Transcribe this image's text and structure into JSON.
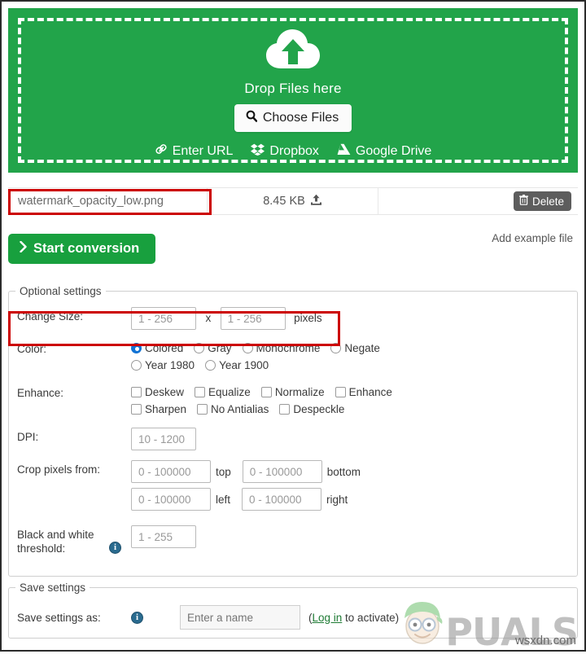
{
  "dropzone": {
    "icon": "cloud-upload-icon",
    "drop_label": "Drop Files here",
    "choose_files_label": "Choose Files",
    "choose_files_icon": "search-icon",
    "sources": [
      {
        "label": "Enter URL",
        "icon": "link-icon"
      },
      {
        "label": "Dropbox",
        "icon": "dropbox-icon"
      },
      {
        "label": "Google Drive",
        "icon": "google-drive-icon"
      }
    ],
    "background_color": "#22a44a"
  },
  "file_row": {
    "name": "watermark_opacity_low.png",
    "size": "8.45 KB",
    "upload_icon": "upload-icon",
    "delete_label": "Delete",
    "delete_icon": "trash-icon"
  },
  "actions": {
    "start_conversion_label": "Start conversion",
    "start_conversion_icon": "chevron-right-icon",
    "add_example_label": "Add example file"
  },
  "optional_settings": {
    "legend": "Optional settings",
    "change_size": {
      "label": "Change Size:",
      "width_placeholder": "1 - 256",
      "width_value": "",
      "separator": "x",
      "height_placeholder": "1 - 256",
      "height_value": "",
      "unit": "pixels"
    },
    "color": {
      "label": "Color:",
      "options": [
        {
          "label": "Colored",
          "checked": true
        },
        {
          "label": "Gray",
          "checked": false
        },
        {
          "label": "Monochrome",
          "checked": false
        },
        {
          "label": "Negate",
          "checked": false
        },
        {
          "label": "Year 1980",
          "checked": false
        },
        {
          "label": "Year 1900",
          "checked": false
        }
      ],
      "selected": "Colored"
    },
    "enhance": {
      "label": "Enhance:",
      "options": [
        {
          "label": "Deskew",
          "checked": false
        },
        {
          "label": "Equalize",
          "checked": false
        },
        {
          "label": "Normalize",
          "checked": false
        },
        {
          "label": "Enhance",
          "checked": false
        },
        {
          "label": "Sharpen",
          "checked": false
        },
        {
          "label": "No Antialias",
          "checked": false
        },
        {
          "label": "Despeckle",
          "checked": false
        }
      ]
    },
    "dpi": {
      "label": "DPI:",
      "placeholder": "10 - 1200",
      "value": ""
    },
    "crop": {
      "label": "Crop pixels from:",
      "fields": [
        {
          "placeholder": "0 - 100000",
          "value": "",
          "unit": "top"
        },
        {
          "placeholder": "0 - 100000",
          "value": "",
          "unit": "bottom"
        },
        {
          "placeholder": "0 - 100000",
          "value": "",
          "unit": "left"
        },
        {
          "placeholder": "0 - 100000",
          "value": "",
          "unit": "right"
        }
      ]
    },
    "bw_threshold": {
      "label": "Black and white threshold:",
      "placeholder": "1 - 255",
      "value": "",
      "info_icon": "info-icon"
    }
  },
  "save_settings": {
    "legend": "Save settings",
    "label": "Save settings as:",
    "info_icon": "info-icon",
    "placeholder": "Enter a name",
    "value": "",
    "hint_prefix": "(",
    "hint_link": "Log in",
    "hint_suffix": " to activate)"
  },
  "annotations": {
    "highlight_color": "#cc0000",
    "boxes": [
      "filename-field",
      "change-size-row"
    ]
  },
  "watermarks": {
    "brand_text": "PUALS",
    "site_text": "wsxdn.com"
  }
}
